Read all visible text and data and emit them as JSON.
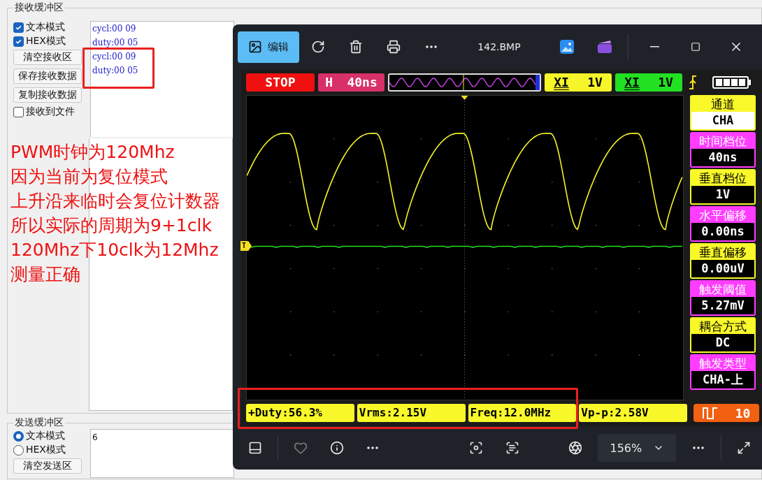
{
  "receive_group": {
    "title": "接收缓冲区",
    "options": [
      {
        "label": "文本模式",
        "checked": true
      },
      {
        "label": "HEX模式",
        "checked": true
      }
    ],
    "buttons": [
      "清空接收区",
      "保存接收数据",
      "复制接收数据"
    ],
    "save_to_file": {
      "label": "接收到文件",
      "checked": false
    },
    "lines": [
      "cycl:00 09",
      "duty:00 05",
      "cycl:00 09",
      "duty:00 05"
    ]
  },
  "annotation": [
    "PWM时钟为120Mhz",
    "因为当前为复位模式",
    "上升沿来临时会复位计数器",
    "所以实际的周期为9+1clk",
    "120Mhz下10clk为12Mhz",
    "测量正确"
  ],
  "send_group": {
    "title": "发送缓冲区",
    "modes": [
      {
        "label": "文本模式",
        "selected": true
      },
      {
        "label": "HEX模式",
        "selected": false
      }
    ],
    "buttons": [
      "清空发送区"
    ],
    "text": "6"
  },
  "viewer": {
    "edit_button": "编辑",
    "file_name": "142.BMP",
    "zoom": "156%"
  },
  "scope": {
    "status": "STOP",
    "timebase": {
      "prefix": "H",
      "value": "40ns"
    },
    "channels": [
      {
        "label": "XI",
        "value": "1V",
        "color": "#f5f52a"
      },
      {
        "label": "XI",
        "value": "1V",
        "color": "#22e022"
      }
    ],
    "trigger_marker": "T",
    "side_panel": [
      {
        "label": "通道",
        "value": "CHA",
        "color": "#f8f82a",
        "selected": true
      },
      {
        "label": "时间档位",
        "value": "40ns",
        "color": "#ff3cff",
        "selected": false
      },
      {
        "label": "垂直档位",
        "value": "1V",
        "color": "#f8f82a",
        "selected": false
      },
      {
        "label": "水平偏移",
        "value": "0.00ns",
        "color": "#ff3cff",
        "selected": false
      },
      {
        "label": "垂直偏移",
        "value": "0.00uV",
        "color": "#f8f82a",
        "selected": false
      },
      {
        "label": "触发阈值",
        "value": "5.27mV",
        "color": "#ff3cff",
        "selected": false
      },
      {
        "label": "耦合方式",
        "value": "DC",
        "color": "#f8f82a",
        "selected": false
      },
      {
        "label": "触发类型",
        "value": "CHA-上",
        "color": "#ff3cff",
        "selected": false
      }
    ],
    "measurements": [
      "+Duty:56.3%",
      "Vrms:2.15V",
      "Freq:12.0MHz",
      "Vp-p:2.58V"
    ],
    "counter": "10"
  }
}
